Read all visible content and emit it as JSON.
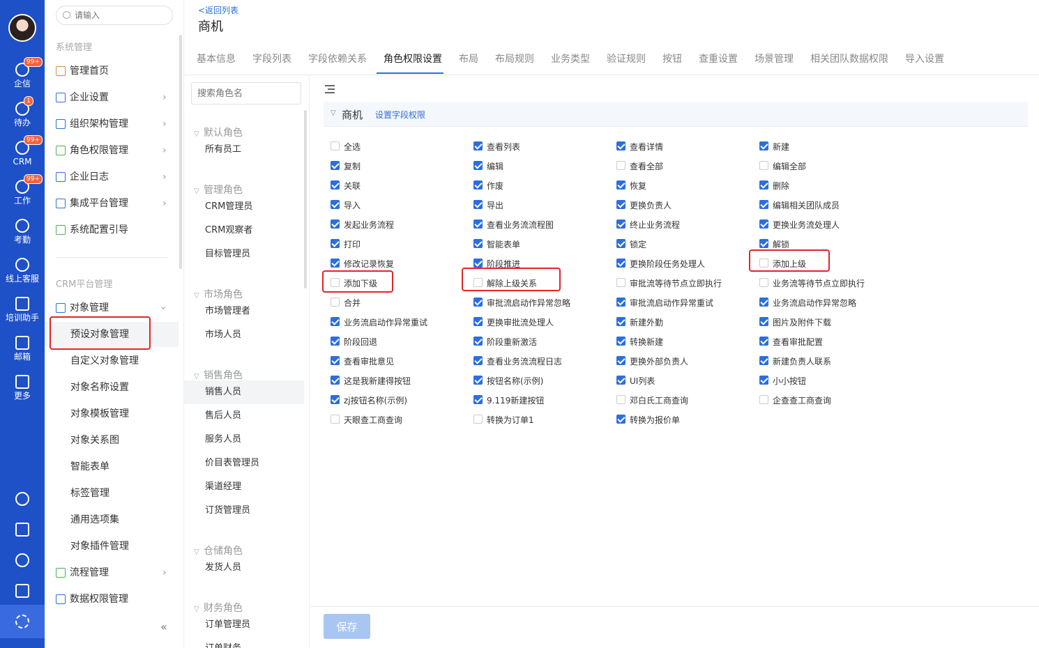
{
  "rail": {
    "items": [
      {
        "label": "企信",
        "badge": "99+"
      },
      {
        "label": "待办",
        "badge": "1"
      },
      {
        "label": "CRM",
        "badge": "99+"
      },
      {
        "label": "工作",
        "badge": "99+"
      },
      {
        "label": "考勤",
        "badge": ""
      },
      {
        "label": "线上客服",
        "badge": ""
      },
      {
        "label": "培训助手",
        "badge": ""
      },
      {
        "label": "邮箱",
        "badge": ""
      },
      {
        "label": "更多",
        "badge": ""
      }
    ]
  },
  "menu": {
    "search_placeholder": "请输入",
    "group1": "系统管理",
    "items1": [
      "管理首页",
      "企业设置",
      "组织架构管理",
      "角色权限管理",
      "企业日志",
      "集成平台管理",
      "系统配置引导"
    ],
    "group2": "CRM平台管理",
    "object_mgmt": "对象管理",
    "sub_items": [
      "预设对象管理",
      "自定义对象管理",
      "对象名称设置",
      "对象模板管理",
      "对象关系图",
      "智能表单",
      "标签管理",
      "通用选项集",
      "对象插件管理"
    ],
    "flow_mgmt": "流程管理",
    "data_perm": "数据权限管理",
    "collapse": "«"
  },
  "header": {
    "back": "<返回列表",
    "title": "商机"
  },
  "tabs": [
    "基本信息",
    "字段列表",
    "字段依赖关系",
    "角色权限设置",
    "布局",
    "布局规则",
    "业务类型",
    "验证规则",
    "按钮",
    "查重设置",
    "场景管理",
    "相关团队数据权限",
    "导入设置"
  ],
  "roles": {
    "search_placeholder": "搜索角色名",
    "groups": [
      {
        "name": "默认角色",
        "items": [
          "所有员工"
        ]
      },
      {
        "name": "管理角色",
        "items": [
          "CRM管理员",
          "CRM观察者",
          "目标管理员"
        ]
      },
      {
        "name": "市场角色",
        "items": [
          "市场管理者",
          "市场人员"
        ]
      },
      {
        "name": "销售角色",
        "items": [
          "销售人员",
          "售后人员",
          "服务人员",
          "价目表管理员",
          "渠道经理",
          "订货管理员"
        ]
      },
      {
        "name": "仓储角色",
        "items": [
          "发货人员"
        ]
      },
      {
        "name": "财务角色",
        "items": [
          "订单管理员",
          "订单财务"
        ]
      }
    ]
  },
  "section": {
    "title": "商机",
    "link": "设置字段权限"
  },
  "permissions": [
    [
      {
        "l": "全选",
        "c": false
      },
      {
        "l": "查看列表",
        "c": true
      },
      {
        "l": "查看详情",
        "c": true
      },
      {
        "l": "新建",
        "c": true
      }
    ],
    [
      {
        "l": "复制",
        "c": true
      },
      {
        "l": "编辑",
        "c": true
      },
      {
        "l": "查看全部",
        "c": false
      },
      {
        "l": "编辑全部",
        "c": false
      }
    ],
    [
      {
        "l": "关联",
        "c": true
      },
      {
        "l": "作废",
        "c": true
      },
      {
        "l": "恢复",
        "c": true
      },
      {
        "l": "删除",
        "c": true
      }
    ],
    [
      {
        "l": "导入",
        "c": true
      },
      {
        "l": "导出",
        "c": true
      },
      {
        "l": "更换负责人",
        "c": true
      },
      {
        "l": "编辑相关团队成员",
        "c": true
      }
    ],
    [
      {
        "l": "发起业务流程",
        "c": true
      },
      {
        "l": "查看业务流流程图",
        "c": true
      },
      {
        "l": "终止业务流程",
        "c": true
      },
      {
        "l": "更换业务流处理人",
        "c": true
      }
    ],
    [
      {
        "l": "打印",
        "c": true
      },
      {
        "l": "智能表单",
        "c": true
      },
      {
        "l": "锁定",
        "c": true
      },
      {
        "l": "解锁",
        "c": true
      }
    ],
    [
      {
        "l": "修改记录恢复",
        "c": true
      },
      {
        "l": "阶段推进",
        "c": true
      },
      {
        "l": "更换阶段任务处理人",
        "c": true
      },
      {
        "l": "添加上级",
        "c": false
      }
    ],
    [
      {
        "l": "添加下级",
        "c": false
      },
      {
        "l": "解除上级关系",
        "c": false
      },
      {
        "l": "审批流等待节点立即执行",
        "c": false
      },
      {
        "l": "业务流等待节点立即执行",
        "c": false
      }
    ],
    [
      {
        "l": "合并",
        "c": false
      },
      {
        "l": "审批流启动作异常忽略",
        "c": true
      },
      {
        "l": "审批流启动作异常重试",
        "c": true
      },
      {
        "l": "业务流启动作异常忽略",
        "c": true
      }
    ],
    [
      {
        "l": "业务流启动作异常重试",
        "c": true
      },
      {
        "l": "更换审批流处理人",
        "c": true
      },
      {
        "l": "新建外勤",
        "c": true
      },
      {
        "l": "图片及附件下载",
        "c": true
      }
    ],
    [
      {
        "l": "阶段回退",
        "c": true
      },
      {
        "l": "阶段重新激活",
        "c": true
      },
      {
        "l": "转换新建",
        "c": true
      },
      {
        "l": "查看审批配置",
        "c": true
      }
    ],
    [
      {
        "l": "查看审批意见",
        "c": true
      },
      {
        "l": "查看业务流流程日志",
        "c": true
      },
      {
        "l": "更换外部负责人",
        "c": true
      },
      {
        "l": "新建负责人联系",
        "c": true
      }
    ],
    [
      {
        "l": "这是我新建得按钮",
        "c": true
      },
      {
        "l": "按钮名称(示例)",
        "c": true
      },
      {
        "l": "UI列表",
        "c": true
      },
      {
        "l": "小小按钮",
        "c": true
      }
    ],
    [
      {
        "l": "zj按钮名称(示例)",
        "c": true
      },
      {
        "l": "9.119新建按钮",
        "c": true
      },
      {
        "l": "邓白氏工商查询",
        "c": false
      },
      {
        "l": "企查查工商查询",
        "c": false
      }
    ],
    [
      {
        "l": "天眼查工商查询",
        "c": false
      },
      {
        "l": "转换为订单1",
        "c": false
      },
      {
        "l": "转换为报价单",
        "c": true
      }
    ]
  ],
  "footer": {
    "save": "保存"
  },
  "colors": {
    "rail": "#1e50c8",
    "accent": "#2c6ee0",
    "highlight": "#e0252a"
  }
}
